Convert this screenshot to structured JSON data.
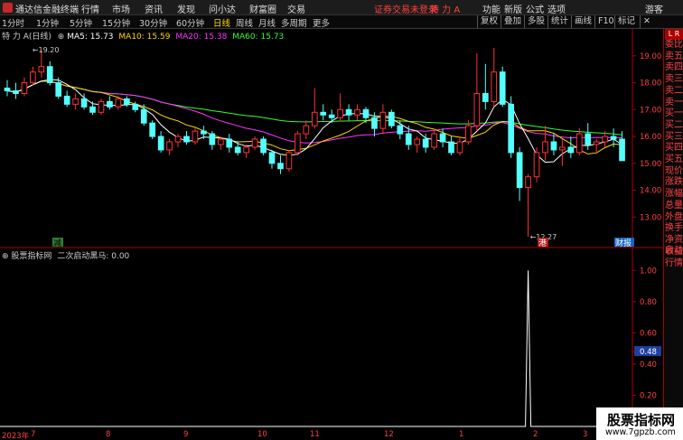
{
  "titlebar": {
    "app_name": "通达信金融终端",
    "menus": [
      "行情",
      "市场",
      "资讯",
      "发现",
      "问小达",
      "财富圈",
      "交易"
    ],
    "notice": "证券交易未登录",
    "stock_name": "特 力 A",
    "right_items": [
      "功能",
      "新版",
      "公式",
      "选项",
      "游客"
    ]
  },
  "toolbar": {
    "timeframes": [
      "1分时",
      "1分钟",
      "5分钟",
      "15分钟",
      "30分钟",
      "60分钟",
      "日线",
      "周线",
      "月线",
      "多周期",
      "更多"
    ],
    "active_timeframe": "日线",
    "right_buttons": [
      "复权",
      "叠加",
      "多股",
      "统计",
      "画线",
      "F10",
      "标记",
      "✕"
    ]
  },
  "main_legend": {
    "stock": "特 力 A",
    "period": "(日线)",
    "ma5": "MA5: 15.73",
    "ma10": "MA10: 15.59",
    "ma20": "MA20: 15.38",
    "ma60": "MA60: 15.73",
    "colors": {
      "ma5": "#ffffff",
      "ma10": "#ffd700",
      "ma20": "#ff33ff",
      "ma60": "#33ff33"
    }
  },
  "price_axis": {
    "ticks": [
      "19.00",
      "18.00",
      "17.00",
      "16.00",
      "15.00",
      "14.00",
      "13.00"
    ],
    "high_label": "19.20",
    "low_label": "12.27"
  },
  "event_markers": {
    "jian": "减",
    "gang": "港",
    "cai_bao": "财报"
  },
  "indicator": {
    "source": "股票指标网",
    "name": "二次启动黑马",
    "value": "0.00",
    "ticks": [
      "1.00",
      "0.80",
      "0.60",
      "0.48",
      "0.40",
      "0.20"
    ]
  },
  "right_panel": {
    "top": "L R",
    "labels": [
      "委比",
      "卖五",
      "卖四",
      "卖三",
      "卖二",
      "卖一",
      "买一",
      "买二",
      "买三",
      "买四",
      "买五",
      "现价",
      "涨跌",
      "涨幅",
      "总量",
      "外盘",
      "换手",
      "净资",
      "收益",
      "自动",
      "行情"
    ]
  },
  "date_axis": {
    "labels": [
      "2023年",
      "7",
      "8",
      "9",
      "10",
      "11",
      "12",
      "1",
      "2",
      "3"
    ]
  },
  "watermark": {
    "line1": "股票指标网",
    "line2": "www.7gpzb.com"
  },
  "chart_data": {
    "type": "candlestick",
    "price_ylim": [
      12.0,
      19.6
    ],
    "indicator_ylim": [
      0,
      1.1
    ],
    "candles": [
      [
        17.8,
        18.1,
        17.5,
        17.7
      ],
      [
        17.7,
        18.0,
        17.4,
        17.6
      ],
      [
        17.6,
        18.2,
        17.5,
        18.0
      ],
      [
        18.0,
        18.6,
        17.9,
        18.4
      ],
      [
        18.4,
        19.2,
        18.2,
        18.6
      ],
      [
        18.6,
        18.8,
        17.9,
        18.0
      ],
      [
        18.0,
        18.2,
        17.4,
        17.5
      ],
      [
        17.5,
        17.7,
        17.1,
        17.2
      ],
      [
        17.2,
        17.6,
        17.0,
        17.4
      ],
      [
        17.4,
        17.6,
        17.0,
        17.1
      ],
      [
        17.1,
        17.3,
        16.8,
        16.9
      ],
      [
        16.9,
        17.4,
        16.8,
        17.3
      ],
      [
        17.3,
        17.5,
        17.0,
        17.1
      ],
      [
        17.1,
        17.5,
        17.0,
        17.4
      ],
      [
        17.4,
        17.5,
        17.1,
        17.2
      ],
      [
        17.2,
        17.3,
        16.9,
        17.0
      ],
      [
        17.0,
        17.2,
        16.4,
        16.5
      ],
      [
        16.5,
        16.6,
        15.9,
        16.0
      ],
      [
        16.0,
        16.2,
        15.4,
        15.5
      ],
      [
        15.5,
        15.9,
        15.3,
        15.8
      ],
      [
        15.8,
        16.1,
        15.6,
        16.0
      ],
      [
        16.0,
        16.2,
        15.7,
        15.8
      ],
      [
        15.8,
        16.3,
        15.7,
        16.2
      ],
      [
        16.2,
        16.4,
        15.9,
        16.1
      ],
      [
        16.1,
        16.2,
        15.5,
        15.7
      ],
      [
        15.7,
        16.0,
        15.5,
        15.9
      ],
      [
        15.9,
        16.1,
        15.4,
        15.6
      ],
      [
        15.6,
        15.8,
        15.3,
        15.4
      ],
      [
        15.4,
        15.7,
        15.2,
        15.6
      ],
      [
        15.6,
        16.0,
        15.5,
        15.9
      ],
      [
        15.9,
        16.0,
        15.3,
        15.4
      ],
      [
        15.4,
        15.5,
        14.8,
        15.0
      ],
      [
        15.0,
        15.3,
        14.6,
        14.8
      ],
      [
        14.8,
        15.5,
        14.7,
        15.4
      ],
      [
        15.4,
        16.2,
        15.3,
        16.1
      ],
      [
        16.1,
        16.6,
        15.9,
        16.4
      ],
      [
        16.4,
        17.8,
        16.3,
        16.9
      ],
      [
        16.9,
        17.2,
        16.6,
        16.8
      ],
      [
        16.8,
        17.0,
        16.5,
        16.7
      ],
      [
        16.7,
        17.6,
        16.6,
        17.0
      ],
      [
        17.0,
        17.2,
        16.6,
        16.8
      ],
      [
        16.8,
        17.2,
        16.6,
        17.0
      ],
      [
        17.0,
        17.1,
        16.5,
        16.7
      ],
      [
        16.7,
        16.9,
        16.0,
        16.3
      ],
      [
        16.3,
        17.2,
        16.1,
        16.9
      ],
      [
        16.9,
        17.0,
        16.3,
        16.4
      ],
      [
        16.4,
        16.6,
        15.9,
        16.1
      ],
      [
        16.1,
        16.4,
        15.5,
        15.7
      ],
      [
        15.7,
        16.0,
        15.4,
        15.9
      ],
      [
        15.9,
        16.1,
        15.4,
        15.6
      ],
      [
        15.6,
        16.3,
        15.5,
        16.1
      ],
      [
        16.1,
        16.3,
        15.6,
        15.8
      ],
      [
        15.8,
        16.0,
        15.3,
        15.4
      ],
      [
        15.4,
        16.0,
        15.3,
        15.8
      ],
      [
        15.8,
        16.6,
        15.7,
        16.4
      ],
      [
        16.4,
        19.1,
        16.2,
        17.6
      ],
      [
        17.6,
        18.7,
        17.0,
        17.3
      ],
      [
        17.3,
        19.3,
        17.1,
        18.4
      ],
      [
        18.4,
        18.6,
        17.1,
        17.2
      ],
      [
        17.2,
        17.5,
        15.2,
        15.4
      ],
      [
        15.4,
        15.6,
        13.6,
        14.1
      ],
      [
        14.1,
        14.6,
        12.27,
        14.5
      ],
      [
        14.5,
        15.6,
        14.3,
        15.4
      ],
      [
        15.4,
        16.4,
        15.1,
        15.8
      ],
      [
        15.8,
        16.1,
        15.3,
        15.5
      ],
      [
        15.5,
        15.9,
        14.9,
        15.6
      ],
      [
        15.6,
        16.0,
        15.2,
        15.4
      ],
      [
        15.4,
        16.3,
        15.3,
        16.1
      ],
      [
        16.1,
        16.5,
        15.5,
        15.7
      ],
      [
        15.7,
        15.9,
        15.4,
        15.8
      ],
      [
        15.8,
        16.2,
        15.6,
        16.0
      ],
      [
        16.0,
        16.3,
        15.6,
        15.9
      ],
      [
        15.9,
        16.2,
        15.3,
        15.1
      ]
    ],
    "indicator_values": {
      "spike_index": 61,
      "spike_value": 1.0,
      "baseline": 0.0
    }
  }
}
